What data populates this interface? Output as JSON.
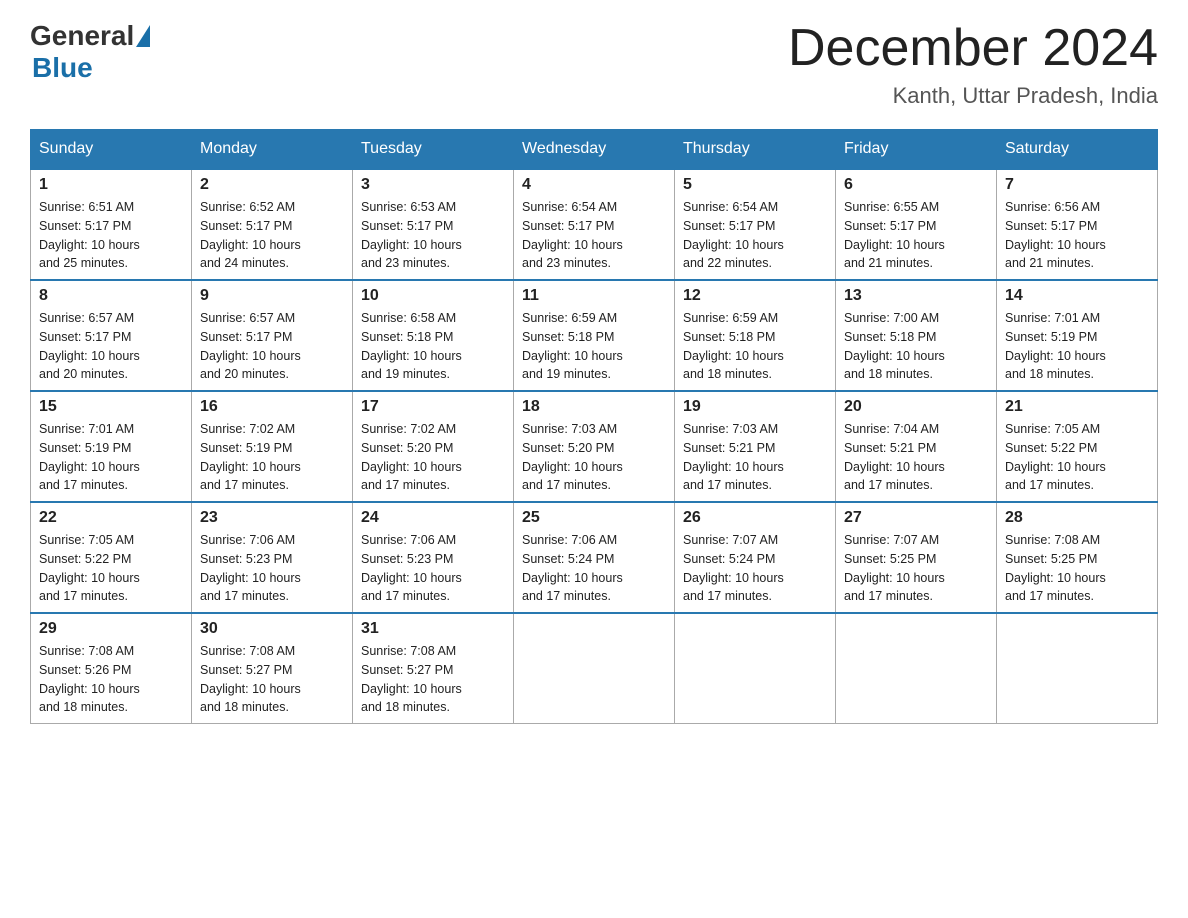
{
  "header": {
    "logo_general": "General",
    "logo_blue": "Blue",
    "month_year": "December 2024",
    "location": "Kanth, Uttar Pradesh, India"
  },
  "days_of_week": [
    "Sunday",
    "Monday",
    "Tuesday",
    "Wednesday",
    "Thursday",
    "Friday",
    "Saturday"
  ],
  "weeks": [
    [
      {
        "day": 1,
        "sunrise": "6:51 AM",
        "sunset": "5:17 PM",
        "daylight": "10 hours and 25 minutes."
      },
      {
        "day": 2,
        "sunrise": "6:52 AM",
        "sunset": "5:17 PM",
        "daylight": "10 hours and 24 minutes."
      },
      {
        "day": 3,
        "sunrise": "6:53 AM",
        "sunset": "5:17 PM",
        "daylight": "10 hours and 23 minutes."
      },
      {
        "day": 4,
        "sunrise": "6:54 AM",
        "sunset": "5:17 PM",
        "daylight": "10 hours and 23 minutes."
      },
      {
        "day": 5,
        "sunrise": "6:54 AM",
        "sunset": "5:17 PM",
        "daylight": "10 hours and 22 minutes."
      },
      {
        "day": 6,
        "sunrise": "6:55 AM",
        "sunset": "5:17 PM",
        "daylight": "10 hours and 21 minutes."
      },
      {
        "day": 7,
        "sunrise": "6:56 AM",
        "sunset": "5:17 PM",
        "daylight": "10 hours and 21 minutes."
      }
    ],
    [
      {
        "day": 8,
        "sunrise": "6:57 AM",
        "sunset": "5:17 PM",
        "daylight": "10 hours and 20 minutes."
      },
      {
        "day": 9,
        "sunrise": "6:57 AM",
        "sunset": "5:17 PM",
        "daylight": "10 hours and 20 minutes."
      },
      {
        "day": 10,
        "sunrise": "6:58 AM",
        "sunset": "5:18 PM",
        "daylight": "10 hours and 19 minutes."
      },
      {
        "day": 11,
        "sunrise": "6:59 AM",
        "sunset": "5:18 PM",
        "daylight": "10 hours and 19 minutes."
      },
      {
        "day": 12,
        "sunrise": "6:59 AM",
        "sunset": "5:18 PM",
        "daylight": "10 hours and 18 minutes."
      },
      {
        "day": 13,
        "sunrise": "7:00 AM",
        "sunset": "5:18 PM",
        "daylight": "10 hours and 18 minutes."
      },
      {
        "day": 14,
        "sunrise": "7:01 AM",
        "sunset": "5:19 PM",
        "daylight": "10 hours and 18 minutes."
      }
    ],
    [
      {
        "day": 15,
        "sunrise": "7:01 AM",
        "sunset": "5:19 PM",
        "daylight": "10 hours and 17 minutes."
      },
      {
        "day": 16,
        "sunrise": "7:02 AM",
        "sunset": "5:19 PM",
        "daylight": "10 hours and 17 minutes."
      },
      {
        "day": 17,
        "sunrise": "7:02 AM",
        "sunset": "5:20 PM",
        "daylight": "10 hours and 17 minutes."
      },
      {
        "day": 18,
        "sunrise": "7:03 AM",
        "sunset": "5:20 PM",
        "daylight": "10 hours and 17 minutes."
      },
      {
        "day": 19,
        "sunrise": "7:03 AM",
        "sunset": "5:21 PM",
        "daylight": "10 hours and 17 minutes."
      },
      {
        "day": 20,
        "sunrise": "7:04 AM",
        "sunset": "5:21 PM",
        "daylight": "10 hours and 17 minutes."
      },
      {
        "day": 21,
        "sunrise": "7:05 AM",
        "sunset": "5:22 PM",
        "daylight": "10 hours and 17 minutes."
      }
    ],
    [
      {
        "day": 22,
        "sunrise": "7:05 AM",
        "sunset": "5:22 PM",
        "daylight": "10 hours and 17 minutes."
      },
      {
        "day": 23,
        "sunrise": "7:06 AM",
        "sunset": "5:23 PM",
        "daylight": "10 hours and 17 minutes."
      },
      {
        "day": 24,
        "sunrise": "7:06 AM",
        "sunset": "5:23 PM",
        "daylight": "10 hours and 17 minutes."
      },
      {
        "day": 25,
        "sunrise": "7:06 AM",
        "sunset": "5:24 PM",
        "daylight": "10 hours and 17 minutes."
      },
      {
        "day": 26,
        "sunrise": "7:07 AM",
        "sunset": "5:24 PM",
        "daylight": "10 hours and 17 minutes."
      },
      {
        "day": 27,
        "sunrise": "7:07 AM",
        "sunset": "5:25 PM",
        "daylight": "10 hours and 17 minutes."
      },
      {
        "day": 28,
        "sunrise": "7:08 AM",
        "sunset": "5:25 PM",
        "daylight": "10 hours and 17 minutes."
      }
    ],
    [
      {
        "day": 29,
        "sunrise": "7:08 AM",
        "sunset": "5:26 PM",
        "daylight": "10 hours and 18 minutes."
      },
      {
        "day": 30,
        "sunrise": "7:08 AM",
        "sunset": "5:27 PM",
        "daylight": "10 hours and 18 minutes."
      },
      {
        "day": 31,
        "sunrise": "7:08 AM",
        "sunset": "5:27 PM",
        "daylight": "10 hours and 18 minutes."
      },
      null,
      null,
      null,
      null
    ]
  ],
  "labels": {
    "sunrise": "Sunrise:",
    "sunset": "Sunset:",
    "daylight": "Daylight:"
  }
}
